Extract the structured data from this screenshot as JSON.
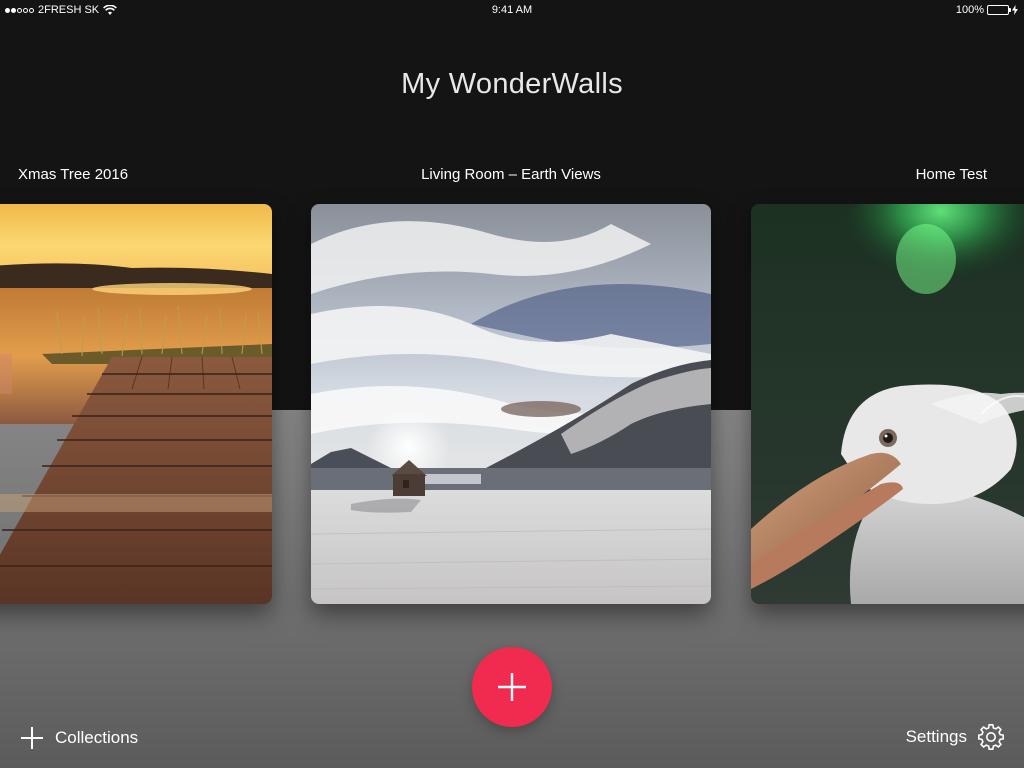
{
  "status_bar": {
    "carrier": "2FRESH SK",
    "time": "9:41 AM",
    "battery": "100%",
    "signal_filled": 2,
    "signal_empty": 3,
    "icons": [
      "wifi-icon",
      "battery-icon",
      "charging-bolt-icon"
    ]
  },
  "header": {
    "title": "My WonderWalls"
  },
  "collections": [
    {
      "label": "Xmas Tree 2016",
      "image": "sunset-lake-dock"
    },
    {
      "label": "Living Room – Earth Views",
      "image": "snowy-fjord-cabin"
    },
    {
      "label": "Home Test",
      "image": "pelican-aurora"
    }
  ],
  "actions": {
    "add_icon": "plus-icon",
    "collections_label": "Collections",
    "collections_icon": "plus-icon",
    "settings_label": "Settings",
    "settings_icon": "gear-icon"
  },
  "colors": {
    "accent": "#f02b4f",
    "top_background": "#141414",
    "bottom_background": "#6f6f6f"
  }
}
